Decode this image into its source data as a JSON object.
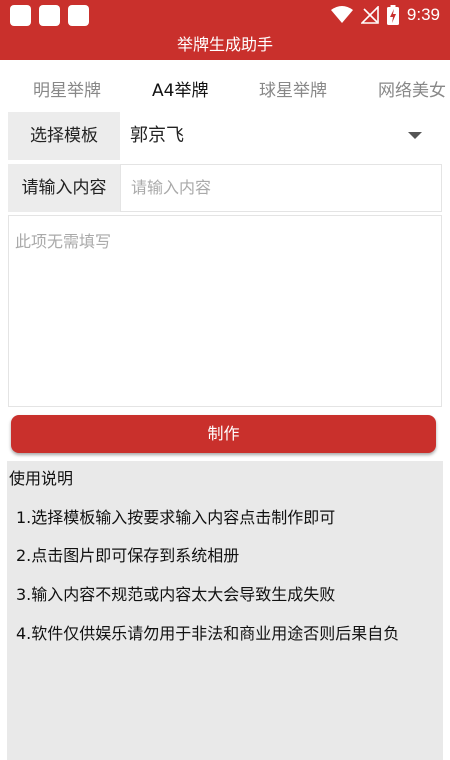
{
  "status_bar": {
    "notification_icons": [
      "app-notification-icon",
      "app-notification-icon",
      "app-notification-icon"
    ],
    "status_icons": [
      "wifi-icon",
      "no-signal-icon",
      "battery-charging-icon"
    ],
    "time": "9:39"
  },
  "app": {
    "title": "举牌生成助手"
  },
  "tabs": [
    {
      "label": "明星举牌",
      "active": false
    },
    {
      "label": "A4举牌",
      "active": true
    },
    {
      "label": "球星举牌",
      "active": false
    },
    {
      "label": "网络美女",
      "active": false
    }
  ],
  "form": {
    "template_label": "选择模板",
    "template_value": "郭京飞",
    "content_label": "请输入内容",
    "content_placeholder": "请输入内容",
    "extra_placeholder": "此项无需填写",
    "make_button": "制作"
  },
  "instructions": {
    "title": "使用说明",
    "items": [
      "1.选择模板输入按要求输入内容点击制作即可",
      "2.点击图片即可保存到系统相册",
      "3.输入内容不规范或内容太大会导致生成失败",
      "4.软件仅供娱乐请勿用于非法和商业用途否则后果自负"
    ]
  },
  "colors": {
    "primary": "#c9302c",
    "label_bg": "#ececec",
    "panel_bg": "#e9e9e9"
  }
}
